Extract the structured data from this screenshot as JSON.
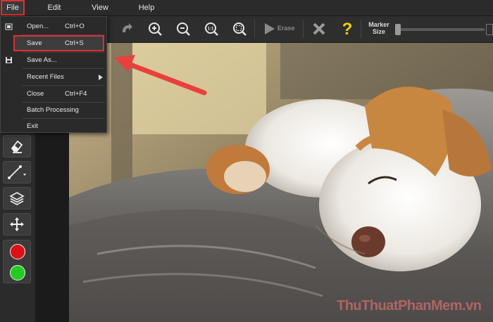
{
  "menubar": {
    "items": [
      "File",
      "Edit",
      "View",
      "Help"
    ]
  },
  "toolbar": {
    "erase_label": "Erase",
    "marker_size_label_1": "Marker",
    "marker_size_label_2": "Size",
    "marker_size_level": 0.05
  },
  "file_menu": {
    "items": [
      {
        "label": "Open...",
        "shortcut": "Ctrl+O"
      },
      {
        "label": "Save",
        "shortcut": "Ctrl+S"
      },
      {
        "label": "Save As...",
        "shortcut": ""
      },
      {
        "label": "Recent Files",
        "shortcut": ""
      },
      {
        "label": "Close",
        "shortcut": "Ctrl+F4"
      },
      {
        "label": "Batch Processing",
        "shortcut": ""
      },
      {
        "label": "Exit",
        "shortcut": ""
      }
    ]
  },
  "colors": {
    "red_marker": "#dd1111",
    "green_marker": "#22cc22",
    "highlight": "#e03030",
    "help_icon": "#f2d000"
  },
  "watermark": "ThuThuatPhanMem.vn"
}
